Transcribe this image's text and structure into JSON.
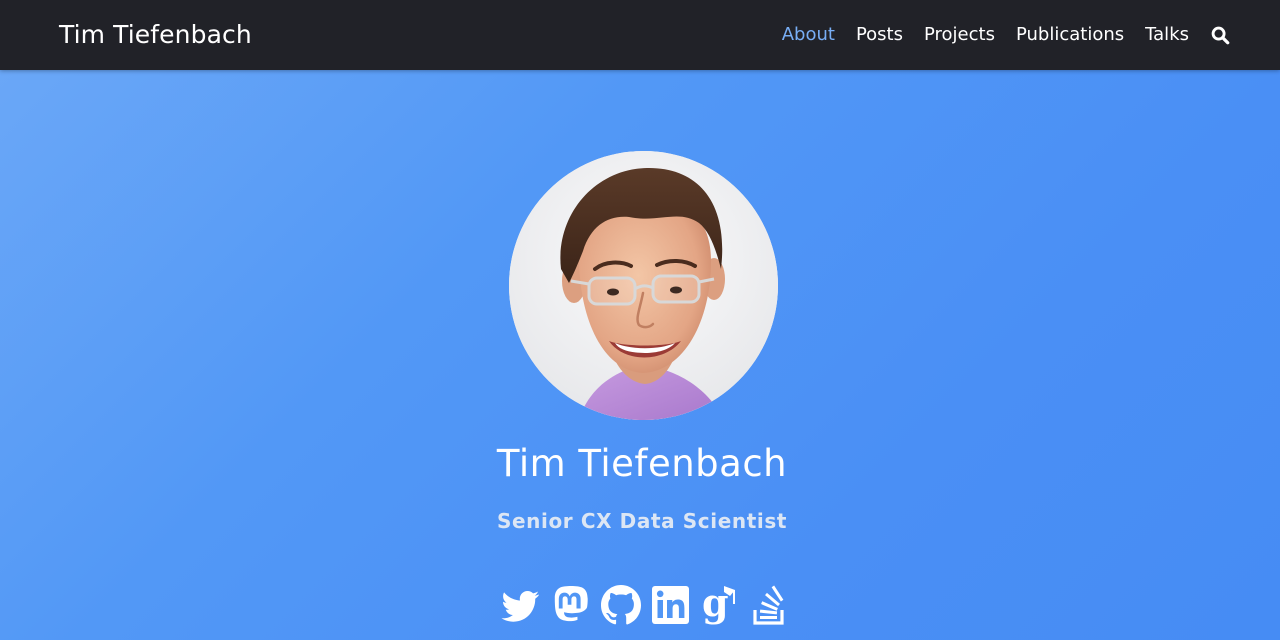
{
  "site": {
    "brand": "Tim Tiefenbach"
  },
  "nav": {
    "items": [
      {
        "label": "About",
        "active": true
      },
      {
        "label": "Posts",
        "active": false
      },
      {
        "label": "Projects",
        "active": false
      },
      {
        "label": "Publications",
        "active": false
      },
      {
        "label": "Talks",
        "active": false
      }
    ],
    "search_icon": "search-icon"
  },
  "profile": {
    "name": "Tim Tiefenbach",
    "role": "Senior CX Data Scientist",
    "avatar_icon": "profile-photo"
  },
  "social": [
    {
      "icon": "twitter-icon"
    },
    {
      "icon": "mastodon-icon"
    },
    {
      "icon": "github-icon"
    },
    {
      "icon": "linkedin-icon"
    },
    {
      "icon": "google-scholar-icon"
    },
    {
      "icon": "stackoverflow-icon"
    }
  ],
  "colors": {
    "navbar_bg": "#212228",
    "nav_active": "#78aef5",
    "hero_gradient_start": "#6aa7f7",
    "hero_gradient_end": "#468cf4",
    "role_text": "#dce6f4"
  }
}
